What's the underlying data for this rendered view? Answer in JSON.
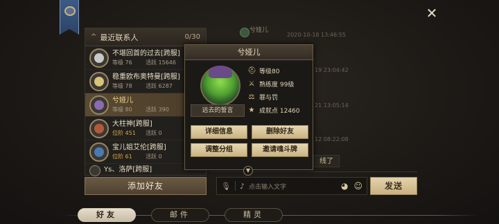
{
  "left_panel": {
    "title": "最近联系人",
    "count": "0/30",
    "contacts": [
      {
        "name": "不堪回首的过去[跨服]",
        "level": "等级 76",
        "activity": "活跃 15646",
        "selected": false
      },
      {
        "name": "稳重欧布奥特曼[跨服]",
        "level": "等级 78",
        "activity": "活跃 6287",
        "selected": false
      },
      {
        "name": "兮娅儿",
        "level": "等级 80",
        "activity": "活跃 390",
        "selected": true
      },
      {
        "name": "大柱神[跨服]",
        "level": "位阶 451",
        "activity": "活跃 0",
        "selected": false
      },
      {
        "name": "宝儿姐艾伦[跨服]",
        "level": "位阶 61",
        "activity": "活跃 0",
        "selected": false
      },
      {
        "name": "Ys、洛萨[跨服]",
        "level": "",
        "activity": "",
        "selected": false
      }
    ],
    "add_friend": "添加好友"
  },
  "chat": {
    "sender": "兮娅儿",
    "timestamps": [
      "2020-10-18 13:46:55",
      "19 23:04:42",
      "21 13:05:14",
      "12 08:22:08"
    ],
    "last_message": "线了"
  },
  "input": {
    "placeholder": "点击输入文字",
    "send_label": "发送"
  },
  "tabs": [
    {
      "label": "好友",
      "active": true
    },
    {
      "label": "邮件",
      "active": false
    },
    {
      "label": "精灵",
      "active": false
    }
  ],
  "popup": {
    "name": "兮娅儿",
    "motto": "远去的誓言",
    "stats": [
      {
        "icon": "helmet-icon",
        "text": "等级80"
      },
      {
        "icon": "sword-icon",
        "text": "熟练度 99级"
      },
      {
        "icon": "scales-icon",
        "text": "罪与罚"
      },
      {
        "icon": "star-icon",
        "text": "成就点 12460"
      }
    ],
    "buttons": {
      "details": "详细信息",
      "delete": "删除好友",
      "group": "调整分组",
      "duel": "邀请魂斗牌"
    }
  }
}
